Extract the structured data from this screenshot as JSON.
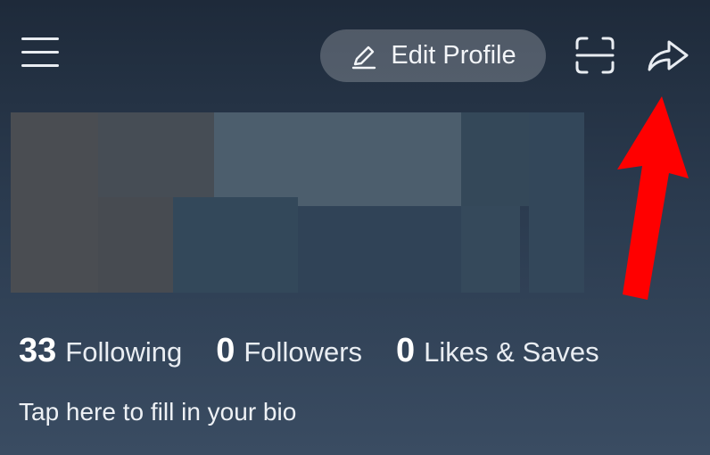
{
  "header": {
    "menu_icon": "hamburger-menu-icon",
    "edit_profile_label": "Edit Profile",
    "edit_icon": "pencil-icon",
    "scan_icon": "scan-icon",
    "share_icon": "share-arrow-icon"
  },
  "annotation": {
    "color": "#ff0000",
    "icon": "red-arrow-pointing-up"
  },
  "stats": [
    {
      "value": "33",
      "label": "Following"
    },
    {
      "value": "0",
      "label": "Followers"
    },
    {
      "value": "0",
      "label": "Likes & Saves"
    }
  ],
  "bio_prompt": "Tap here to fill in your bio"
}
